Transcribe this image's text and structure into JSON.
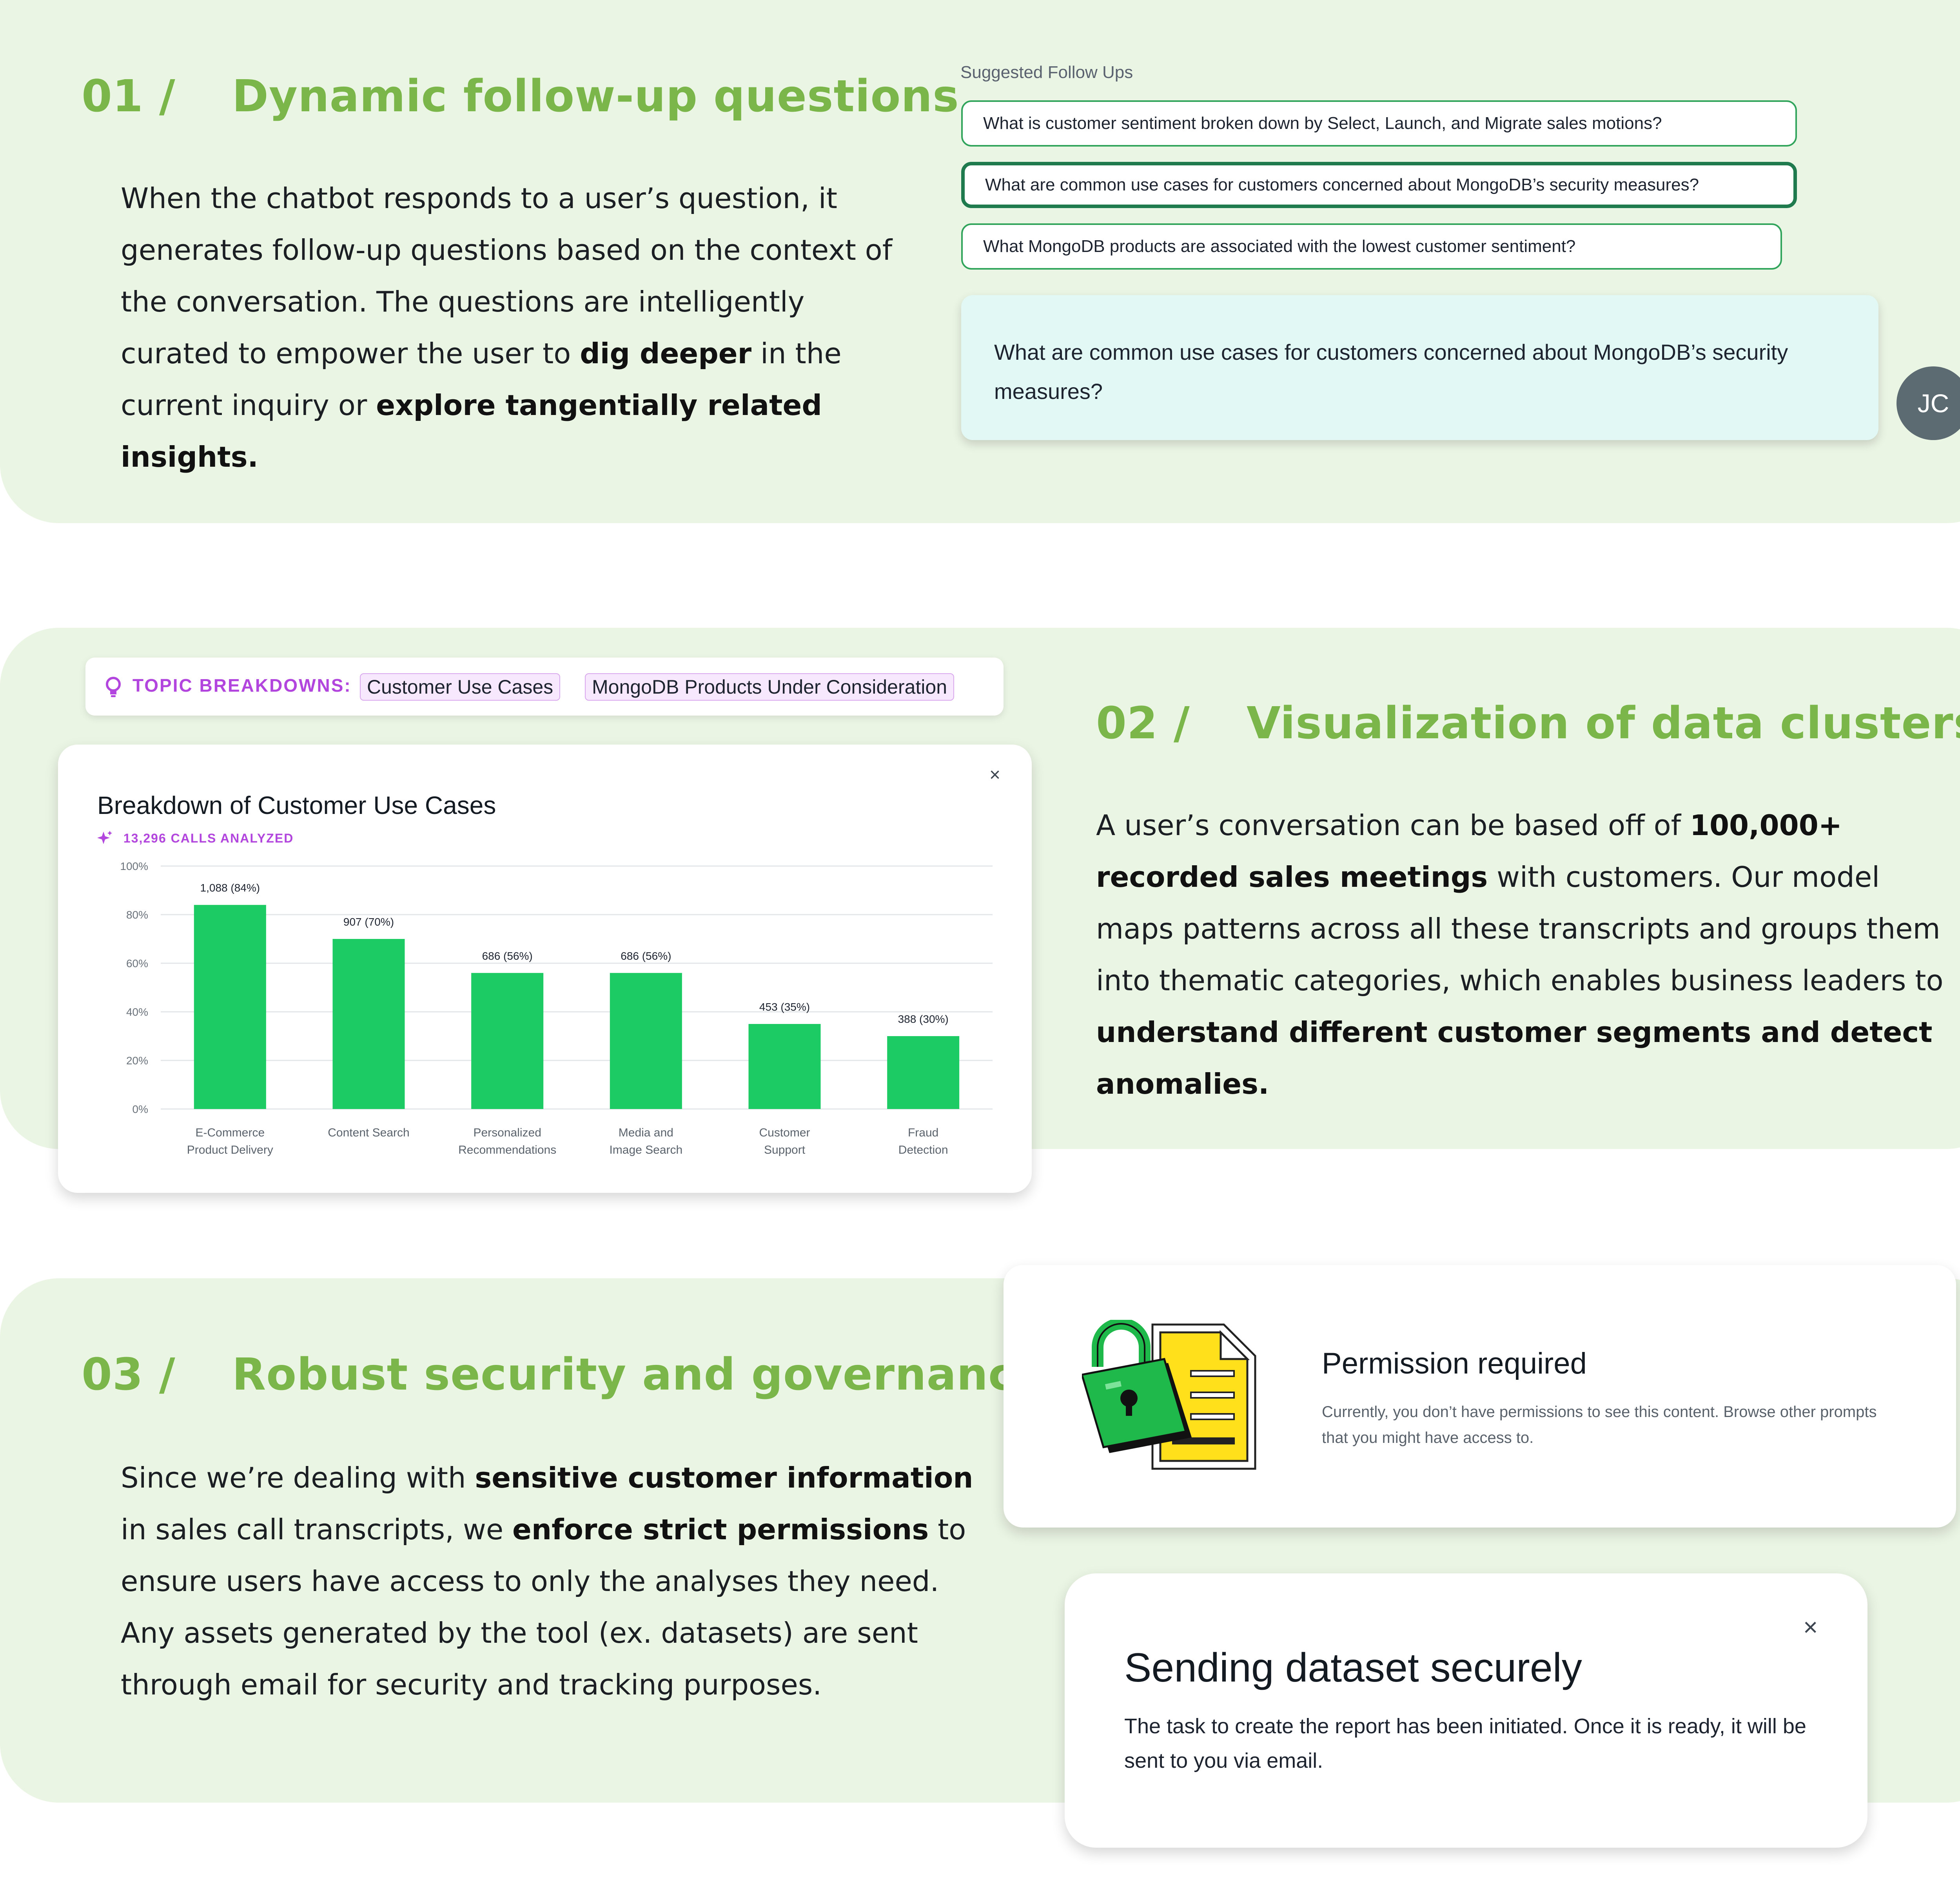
{
  "section1": {
    "number": "01 /",
    "heading": "Dynamic follow-up questions",
    "body": [
      {
        "t": "When the chatbot responds to a user’s question, it generates follow-up questions based on the context of the conversation. The questions are intelligently curated to empower the user to "
      },
      {
        "t": "dig deeper",
        "b": true
      },
      {
        "t": " in the current inquiry or "
      },
      {
        "t": "explore tangentially related insights.",
        "b": true
      }
    ],
    "suggested_label": "Suggested Follow Ups",
    "suggestions": [
      "What is customer sentiment broken down by Select, Launch, and Migrate sales motions?",
      "What are common use cases for customers concerned about MongoDB’s security measures?",
      "What MongoDB products are associated with the lowest customer sentiment?"
    ],
    "user_query": "What are common use cases for customers concerned about MongoDB’s security measures?",
    "avatar_initials": "JC"
  },
  "section2": {
    "number": "02 /",
    "heading": "Visualization of data clusters",
    "body": [
      {
        "t": "A user’s conversation can be based off of "
      },
      {
        "t": "100,000+ recorded sales meetings",
        "b": true
      },
      {
        "t": " with customers. Our model maps patterns across all these transcripts and groups them into thematic categories, which enables business leaders to "
      },
      {
        "t": "understand different customer segments and detect anomalies.",
        "b": true
      }
    ],
    "topic_label": "TOPIC BREAKDOWNS:",
    "topic_chips": [
      "Customer Use Cases",
      "MongoDB Products Under Consideration"
    ],
    "close_symbol": "×"
  },
  "chart_data": {
    "type": "bar",
    "title": "Breakdown of Customer Use Cases",
    "subtitle": "13,296 CALLS ANALYZED",
    "categories": [
      [
        "E-Commerce",
        "Product Delivery"
      ],
      [
        "Content Search"
      ],
      [
        "Personalized",
        "Recommendations"
      ],
      [
        "Media and",
        "Image Search"
      ],
      [
        "Customer",
        "Support"
      ],
      [
        "Fraud",
        "Detection"
      ]
    ],
    "values": [
      84,
      70,
      56,
      56,
      35,
      30
    ],
    "data_labels": [
      "1,088 (84%)",
      "907 (70%)",
      "686 (56%)",
      "686 (56%)",
      "453 (35%)",
      "388 (30%)"
    ],
    "y_ticks": [
      "0%",
      "20%",
      "40%",
      "60%",
      "80%",
      "100%"
    ],
    "ylim": [
      0,
      100
    ],
    "grid": true,
    "bar_color": "#1ccb63"
  },
  "section3": {
    "number": "03 /",
    "heading": "Robust security and governance",
    "body": [
      {
        "t": "Since we’re dealing with "
      },
      {
        "t": "sensitive customer information",
        "b": true
      },
      {
        "t": " in sales call transcripts, we "
      },
      {
        "t": "enforce strict permissions",
        "b": true
      },
      {
        "t": " to ensure users have access to only the analyses they need. Any assets generated by the tool (ex. datasets) are sent through email for security and tracking purposes."
      }
    ],
    "permission": {
      "title": "Permission required",
      "text": "Currently, you don’t have permissions to see this content. Browse other prompts that you might have access to.",
      "icon": "lock-document-icon"
    },
    "sending": {
      "title": "Sending dataset securely",
      "text": "The task to create the report has been initiated. Once it is ready, it will be sent to you via email.",
      "close_symbol": "×"
    }
  },
  "colors": {
    "panel_bg": "#ebf5e4",
    "heading_green": "#7ab649",
    "chip_border": "#30a45a",
    "active_chip_border": "#1f7a4d",
    "purple": "#b245dd",
    "bar_green": "#1ccb63",
    "bubble_bg": "#e2f8f4"
  }
}
